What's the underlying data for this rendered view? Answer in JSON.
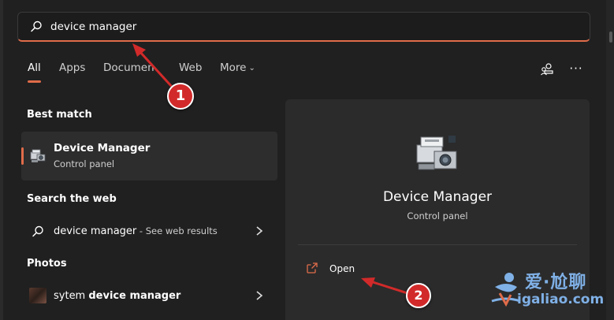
{
  "search": {
    "value": "device manager"
  },
  "tabs": [
    {
      "label": "All",
      "active": true
    },
    {
      "label": "Apps"
    },
    {
      "label": "Documen"
    },
    {
      "label": "Web"
    },
    {
      "label": "More"
    }
  ],
  "results": {
    "best_match_header": "Best match",
    "best_match": {
      "title": "Device Manager",
      "subtitle": "Control panel"
    },
    "search_web_header": "Search the web",
    "web_result": {
      "query": "device manager",
      "suffix": " - See web results"
    },
    "photos_header": "Photos",
    "photo_result": {
      "prefix": "sytem ",
      "bold": "device manager"
    }
  },
  "detail_panel": {
    "title": "Device Manager",
    "subtitle": "Control panel",
    "open_label": "Open"
  },
  "annotations": {
    "callout_1": "1",
    "callout_2": "2",
    "color": "#d22a2a"
  },
  "watermark": {
    "chinese": "爱·尬聊",
    "url": "igaliao.com"
  },
  "colors": {
    "accent": "#e06c4a",
    "background": "#202020",
    "panel": "#2b2b2b",
    "selected_row": "#2d2d2d",
    "watermark": "#7fb0e6"
  },
  "icons": {
    "search": "search-icon",
    "device_manager": "device-manager-icon",
    "open": "external-link-icon",
    "chevron": "chevron-right-icon"
  }
}
